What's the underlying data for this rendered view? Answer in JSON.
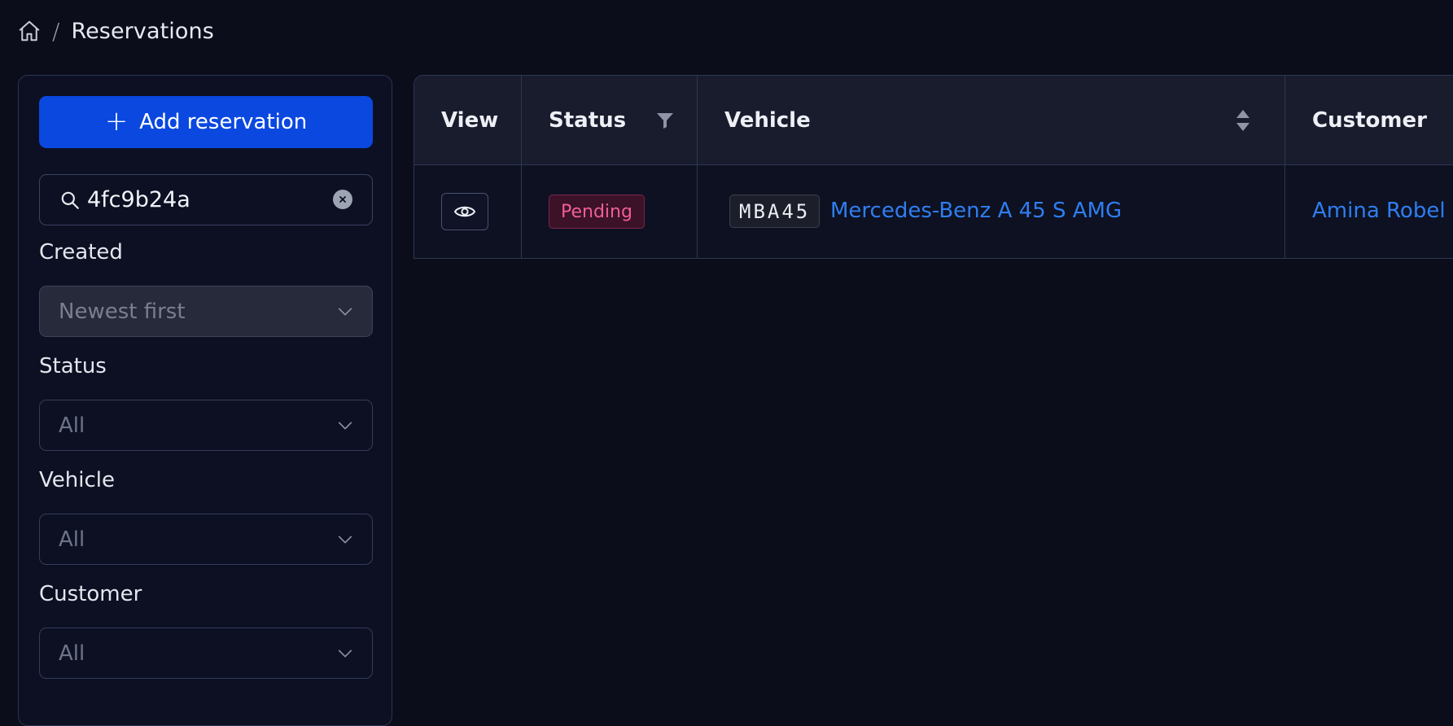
{
  "breadcrumb": {
    "home_icon": "home-icon",
    "separator": "/",
    "current": "Reservations"
  },
  "sidebar": {
    "add_button_label": "Add reservation",
    "search": {
      "value": "4fc9b24a",
      "placeholder": "Search"
    },
    "filters": {
      "created": {
        "label": "Created",
        "value": "Newest first",
        "disabled": true
      },
      "status": {
        "label": "Status",
        "value": "All"
      },
      "vehicle": {
        "label": "Vehicle",
        "value": "All"
      },
      "customer": {
        "label": "Customer",
        "value": "All"
      }
    }
  },
  "table": {
    "columns": {
      "view": "View",
      "status": "Status",
      "vehicle": "Vehicle",
      "customer": "Customer"
    },
    "rows": [
      {
        "status": "Pending",
        "plate": "MBA45",
        "vehicle": "Mercedes-Benz A 45 S AMG",
        "customer": "Amina Robel -"
      }
    ]
  },
  "colors": {
    "background": "#0b0d1a",
    "primary": "#0a48e0",
    "link": "#2f7ef0",
    "pending": "#ee5e97"
  }
}
